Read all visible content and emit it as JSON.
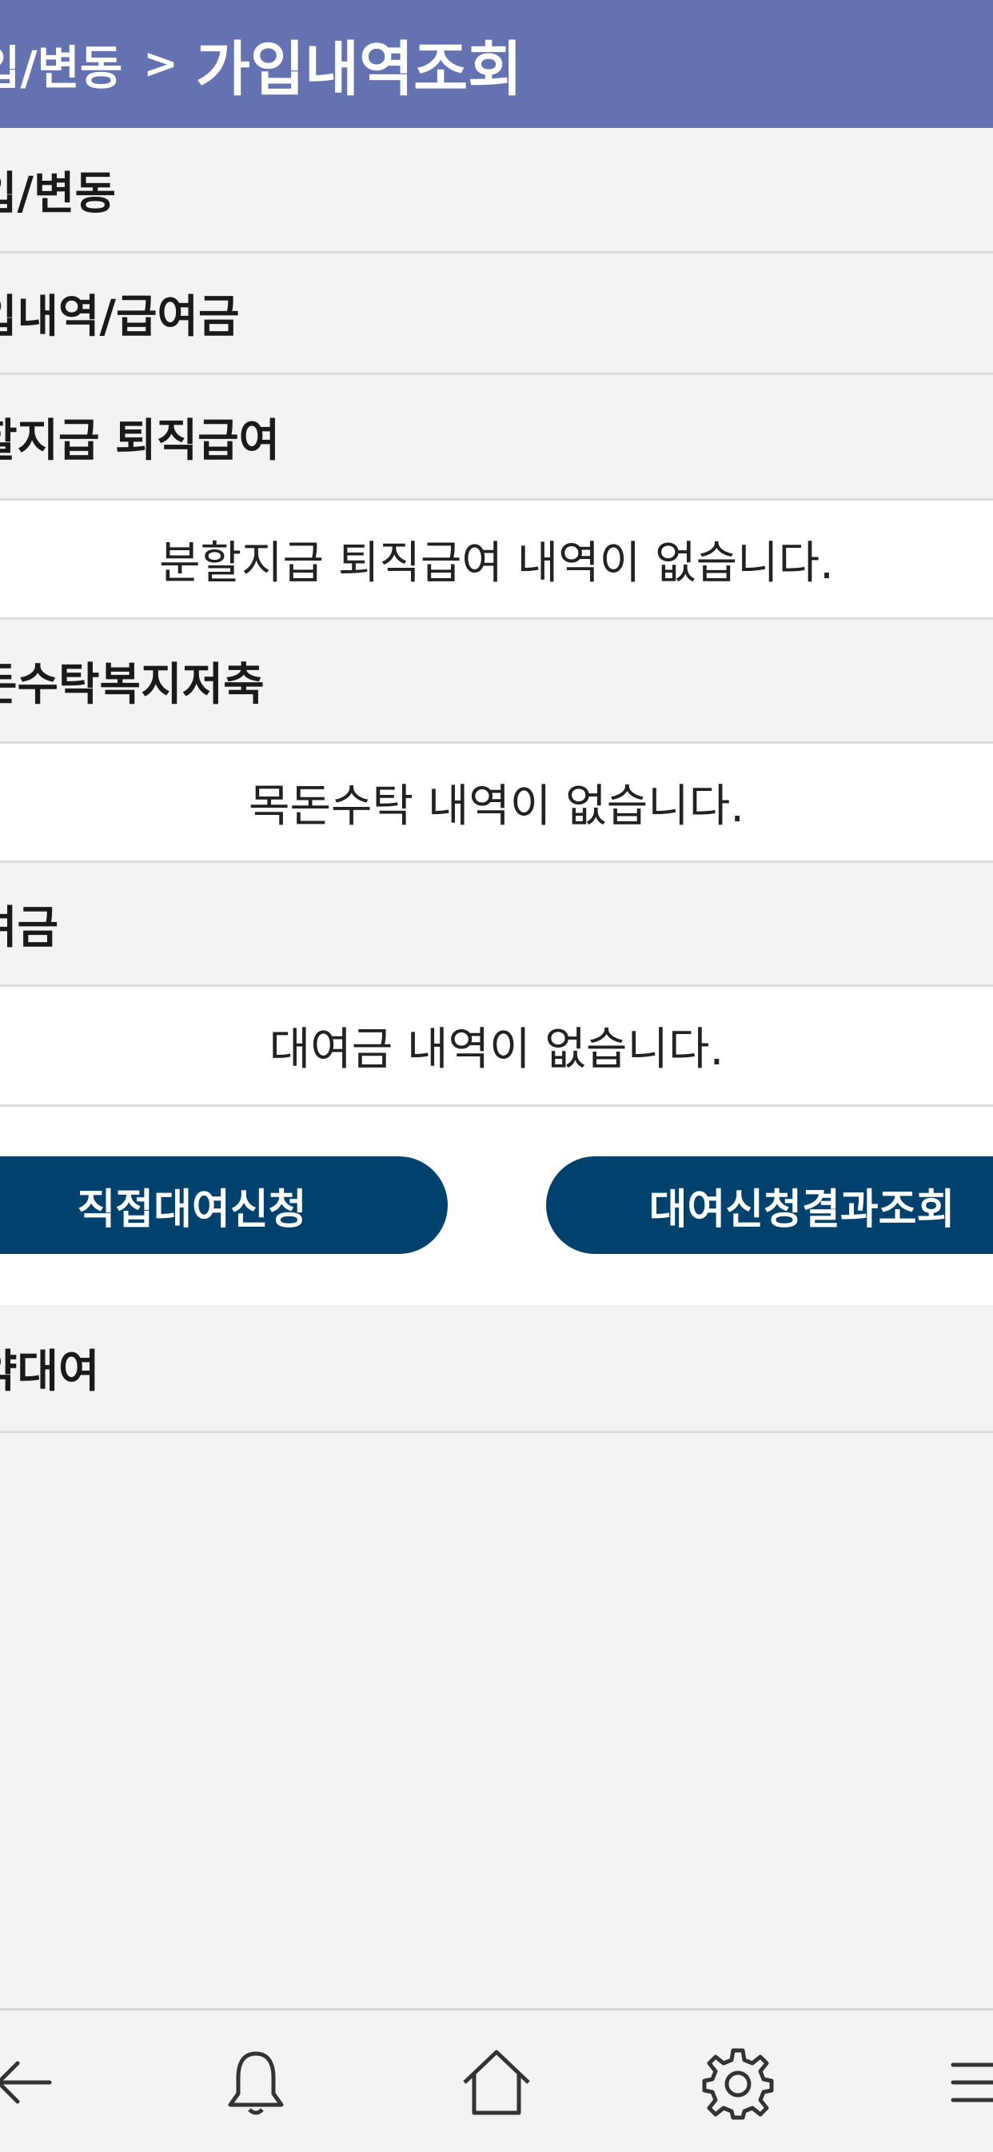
{
  "header": {
    "breadcrumb": "입/변동",
    "separator": ">",
    "title": "가입내역조회"
  },
  "sections": {
    "join_change": "입/변동",
    "history_loan": "입내역/급여금",
    "installment": {
      "label": "할지급 퇴직급여",
      "empty": "분할지급 퇴직급여 내역이 없습니다."
    },
    "trust_savings": {
      "label": "돈수탁복지저축",
      "empty": "목돈수탁 내역이 없습니다."
    },
    "loan": {
      "label": "여금",
      "empty": "대여금 내역이 없습니다."
    },
    "contract_loan": "약대여"
  },
  "buttons": {
    "direct_loan": "직접대여신청",
    "loan_result": "대여신청결과조회"
  },
  "bottom_nav": {
    "items": [
      "back-arrow-icon",
      "bell-icon",
      "home-icon",
      "gear-icon",
      "menu-icon"
    ]
  },
  "colors": {
    "header_bg": "#6472b2",
    "button_bg": "#00416e",
    "page_bg": "#f3f3f3"
  }
}
